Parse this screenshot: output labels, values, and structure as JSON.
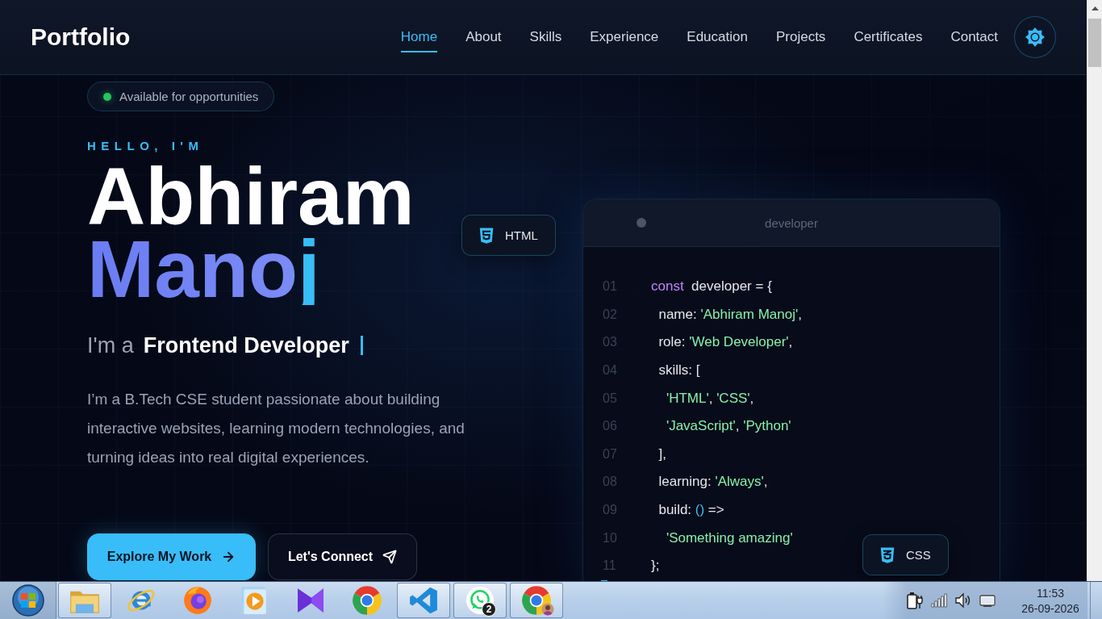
{
  "navbar": {
    "logo": "Portfolio",
    "links": [
      {
        "label": "Home",
        "selected": true
      },
      {
        "label": "About",
        "selected": false
      },
      {
        "label": "Skills",
        "selected": false
      },
      {
        "label": "Experience",
        "selected": false
      },
      {
        "label": "Education",
        "selected": false
      },
      {
        "label": "Projects",
        "selected": false
      },
      {
        "label": "Certificates",
        "selected": false
      },
      {
        "label": "Contact",
        "selected": false
      }
    ]
  },
  "hero": {
    "status": "Available for opportunities",
    "greeting": "HELLO, I'M",
    "first_name": "Abhiram",
    "last_name": "Manoj",
    "role_prefix": "I'm a",
    "role": "Frontend Developer",
    "description": "I’m a B.Tech CSE student passionate about building interactive websites, learning modern technologies, and turning ideas into real digital experiences.",
    "buttons": [
      {
        "label": "Explore My Work",
        "kind": "primary"
      },
      {
        "label": "Let's Connect",
        "kind": "secondary"
      }
    ]
  },
  "code_card": {
    "title": "developer",
    "lines": [
      {
        "number": "01",
        "tokens": [
          {
            "kind": "keyword",
            "text": "const"
          },
          {
            "kind": "plain",
            "text": "  developer = {"
          }
        ]
      },
      {
        "number": "02",
        "tokens": [
          {
            "kind": "plain",
            "text": "  name: "
          },
          {
            "kind": "string",
            "text": "'Abhiram Manoj'"
          },
          {
            "kind": "plain",
            "text": ","
          }
        ]
      },
      {
        "number": "03",
        "tokens": [
          {
            "kind": "plain",
            "text": "  role: "
          },
          {
            "kind": "string",
            "text": "'Web Developer'"
          },
          {
            "kind": "plain",
            "text": ","
          }
        ]
      },
      {
        "number": "04",
        "tokens": [
          {
            "kind": "plain",
            "text": "  skills: ["
          }
        ]
      },
      {
        "number": "05",
        "tokens": [
          {
            "kind": "string",
            "text": "    'HTML'"
          },
          {
            "kind": "plain",
            "text": ", "
          },
          {
            "kind": "string",
            "text": "'CSS'"
          },
          {
            "kind": "plain",
            "text": ","
          }
        ]
      },
      {
        "number": "06",
        "tokens": [
          {
            "kind": "string",
            "text": "    'JavaScript'"
          },
          {
            "kind": "plain",
            "text": ", "
          },
          {
            "kind": "string",
            "text": "'Python'"
          }
        ]
      },
      {
        "number": "07",
        "tokens": [
          {
            "kind": "plain",
            "text": "  ],"
          }
        ]
      },
      {
        "number": "08",
        "tokens": [
          {
            "kind": "plain",
            "text": "  learning: "
          },
          {
            "kind": "string",
            "text": "'Always'"
          },
          {
            "kind": "plain",
            "text": ","
          }
        ]
      },
      {
        "number": "09",
        "tokens": [
          {
            "kind": "plain",
            "text": "  build: "
          },
          {
            "kind": "punct",
            "text": "()"
          },
          {
            "kind": "plain",
            "text": " =>"
          }
        ]
      },
      {
        "number": "10",
        "tokens": [
          {
            "kind": "string",
            "text": "    'Something amazing'"
          }
        ]
      },
      {
        "number": "11",
        "tokens": [
          {
            "kind": "plain",
            "text": "};"
          }
        ]
      }
    ]
  },
  "floating_badges": [
    {
      "label": "HTML",
      "kind": "html"
    },
    {
      "label": "CSS",
      "kind": "css"
    }
  ],
  "taskbar": {
    "apps": [
      {
        "kind": "folder",
        "running": true
      },
      {
        "kind": "letter_e",
        "running": false
      },
      {
        "kind": "flame_globe",
        "running": false
      },
      {
        "kind": "play",
        "running": false
      },
      {
        "kind": "ribbon",
        "running": false
      },
      {
        "kind": "tricolor",
        "running": false
      },
      {
        "kind": "chevron",
        "running": true
      },
      {
        "kind": "chat",
        "running": true,
        "badge": "2"
      },
      {
        "kind": "tricolor",
        "running": true,
        "avatar": true
      }
    ],
    "clock": {
      "time": "11:53",
      "date": "26-09-2026"
    }
  }
}
